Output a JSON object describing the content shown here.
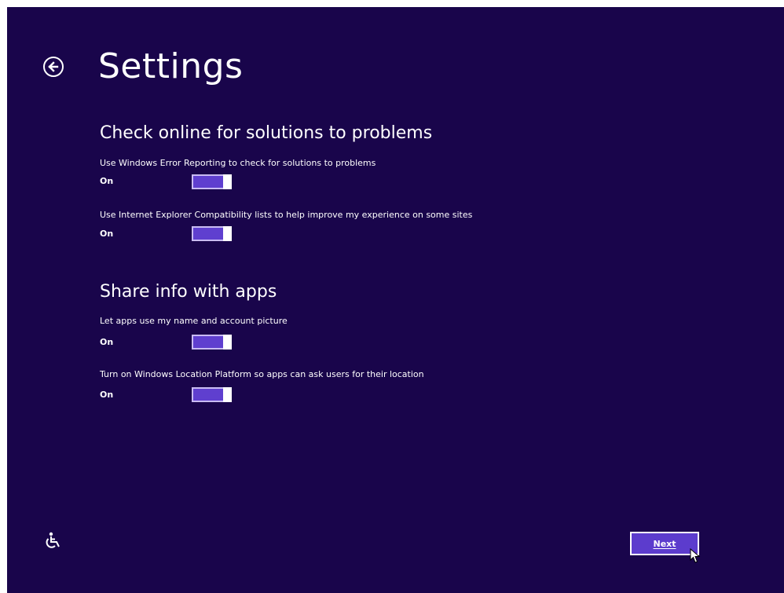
{
  "header": {
    "title": "Settings"
  },
  "sections": [
    {
      "title": "Check online for solutions to problems",
      "items": [
        {
          "label": "Use Windows Error Reporting to check for solutions to problems",
          "state": "On"
        },
        {
          "label": "Use Internet Explorer Compatibility lists to help improve my experience on some sites",
          "state": "On"
        }
      ]
    },
    {
      "title": "Share info with apps",
      "items": [
        {
          "label": "Let apps use my name and account picture",
          "state": "On"
        },
        {
          "label": "Turn on Windows Location Platform so apps can ask users for their location",
          "state": "On"
        }
      ]
    }
  ],
  "footer": {
    "next_label": "Next"
  },
  "icons": {
    "back": "back-arrow-circle-icon",
    "ease_of_access": "ease-of-access-icon",
    "cursor": "mouse-pointer-icon"
  },
  "colors": {
    "background": "#19054b",
    "toggle_fill": "#5f3fcf",
    "button_fill": "#5c3ccd",
    "text": "#ffffff"
  }
}
